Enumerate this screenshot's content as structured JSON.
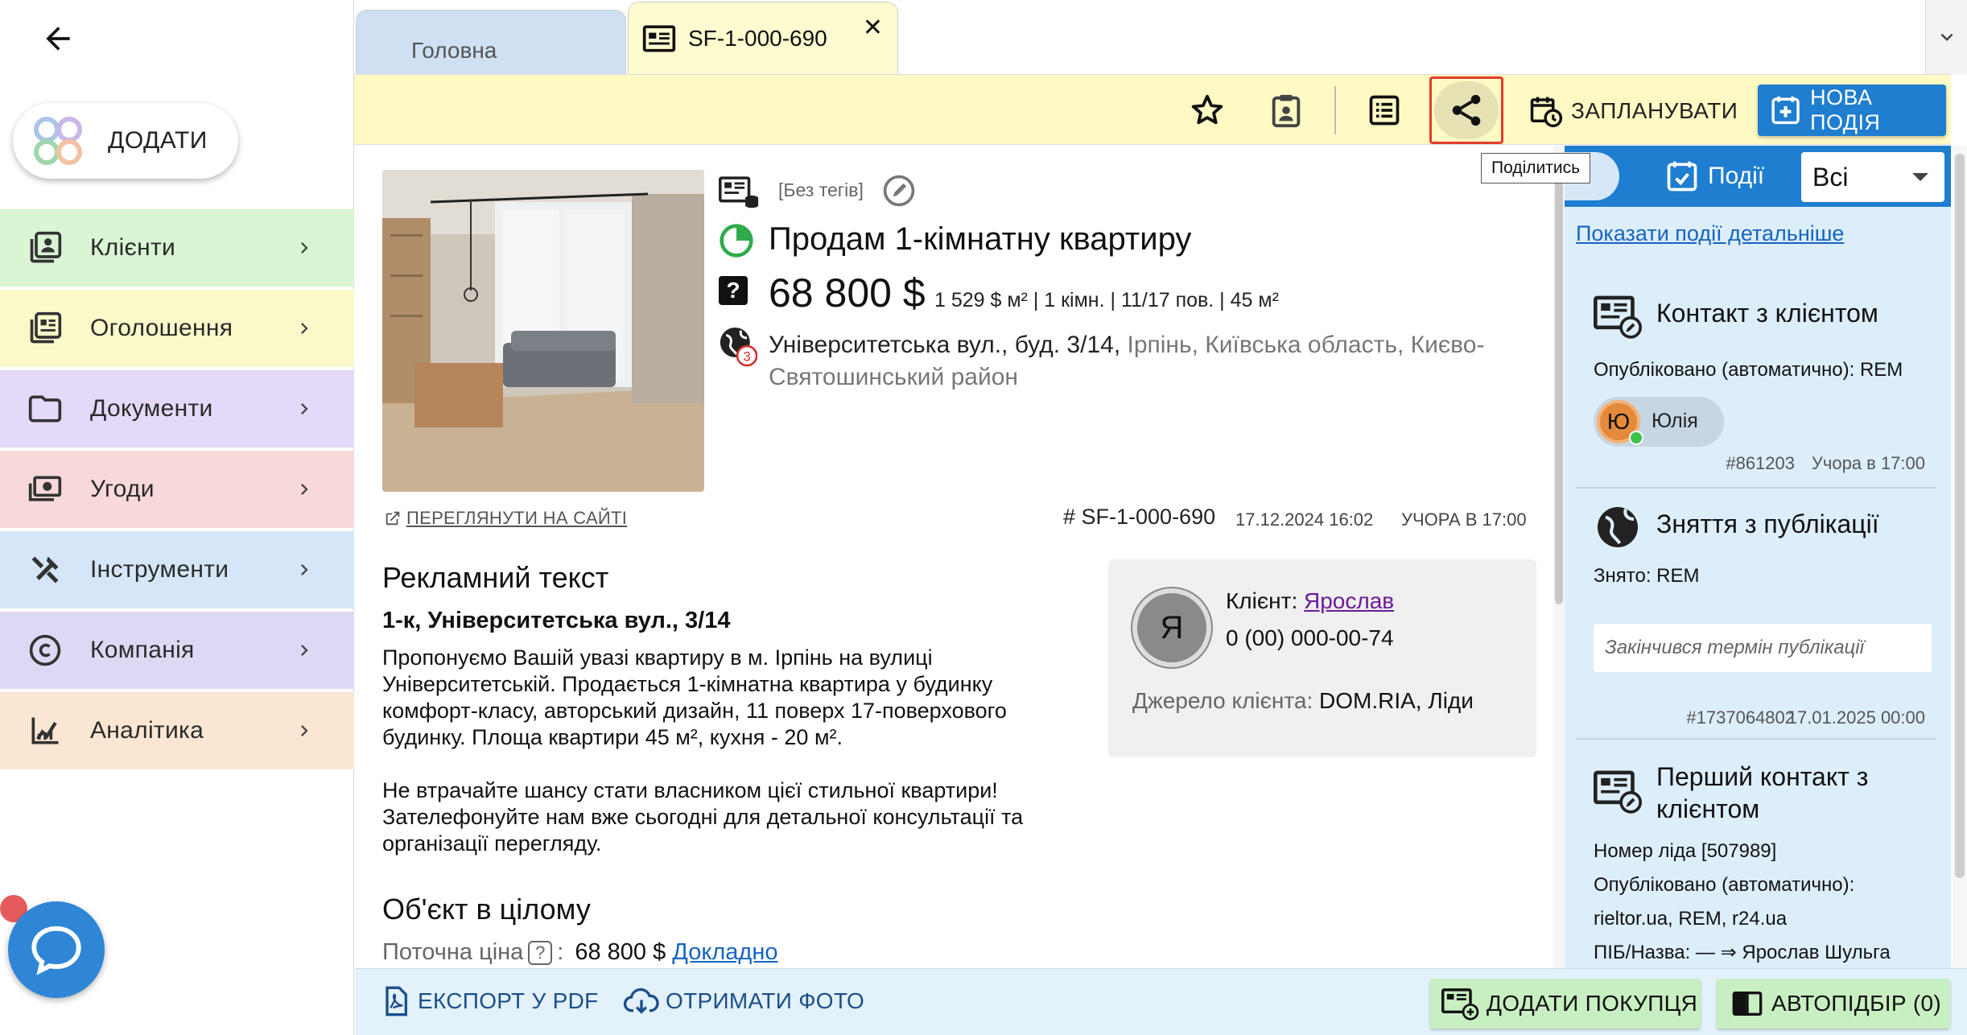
{
  "sidebar": {
    "add_label": "ДОДАТИ",
    "items": [
      {
        "label": "Клієнти",
        "color": "#d9f5d4",
        "icon": "contacts-icon"
      },
      {
        "label": "Оголошення",
        "color": "#fbf9c9",
        "icon": "listing-icon"
      },
      {
        "label": "Документи",
        "color": "#e4d9f8",
        "icon": "folder-icon"
      },
      {
        "label": "Угоди",
        "color": "#f8d9d9",
        "icon": "money-icon"
      },
      {
        "label": "Інструменти",
        "color": "#d4e6f8",
        "icon": "tools-icon"
      },
      {
        "label": "Компанія",
        "color": "#dcd9f5",
        "icon": "copyright-icon"
      },
      {
        "label": "Аналітика",
        "color": "#fae6d2",
        "icon": "analytics-icon"
      }
    ]
  },
  "tabs": {
    "home": "Головна",
    "doc": "SF-1-000-690",
    "close": "✕"
  },
  "toolbar": {
    "plan_label": "ЗАПЛАНУВАТИ",
    "new_event_label": "НОВА ПОДІЯ",
    "share_tooltip": "Поділитись"
  },
  "object": {
    "no_tags": "[Без тегів]",
    "title": "Продам 1-кімнатну квартиру",
    "price": "68 800 $",
    "price_details": "1 529 $ м² | 1 кімн. | 11/17 пов. | 45 м²",
    "address_main": "Університетська вул., буд. 3/14,",
    "address_rest": " Ірпінь, Київська область, Києво-Святошинський район",
    "globe_badge": "3",
    "view_site": "ПЕРЕГЛЯНУТИ НА САЙТІ",
    "id": "# SF-1-000-690",
    "date": "17.12.2024 16:02",
    "yesterday": "УЧОРА В 17:00"
  },
  "ad": {
    "heading": "Рекламний текст",
    "subtitle": "1-к, Університетська вул., 3/14",
    "text": "Пропонуємо Вашій увазі квартиру в м. Ірпінь на вулиці\nУніверситетській. Продається 1-кімнатна квартира у будинку\nкомфорт-класу, авторський дизайн, 11 поверх 17-поверхового\nбудинку. Площа квартири 45 м², кухня - 20 м².\n\nНе втрачайте шансу стати власником цієї стильної квартири!\nЗателефонуйте нам вже сьогодні для детальної консультації та\nорганізації перегляду."
  },
  "whole": {
    "heading": "Об'єкт в цілому",
    "price_label": "Поточна ціна",
    "q": "?",
    "colon": ":",
    "price_value": "68 800 $",
    "more_link": "Докладно"
  },
  "client": {
    "initial": "Я",
    "label": "Клієнт: ",
    "name": "Ярослав",
    "phone": "0 (00) 000-00-74",
    "source_label": "Джерело клієнта: ",
    "source_value": "DOM.RIA, Ліди"
  },
  "events": {
    "header_label": "Події",
    "filter_value": "Всі",
    "show_more": "Показати події детальніше",
    "items": [
      {
        "title": "Контакт з клієнтом",
        "line1": "Опубліковано (автоматично): REM",
        "user_initial": "Ю",
        "user_name": "Юлія",
        "id": "#861203",
        "time": "Учора в 17:00"
      },
      {
        "title": "Зняття з публікації",
        "line1": "Знято: REM",
        "reason": "Закінчився термін публікації",
        "id": "#1737064802",
        "time": "17.01.2025 00:00"
      },
      {
        "title": "Перший контакт з клієнтом",
        "line1": "Номер ліда [507989]",
        "line2": "Опубліковано (автоматично):",
        "line3": "rieltor.ua, REM, r24.ua",
        "line4": "ПІБ/Назва: — ⇒ Ярослав Шульга"
      }
    ]
  },
  "bottom": {
    "export_pdf": "ЕКСПОРТ У PDF",
    "get_photo": "ОТРИМАТИ ФОТО",
    "add_buyer": "ДОДАТИ ПОКУПЦЯ",
    "autoselect": "АВТОПІДБІР (0)"
  }
}
